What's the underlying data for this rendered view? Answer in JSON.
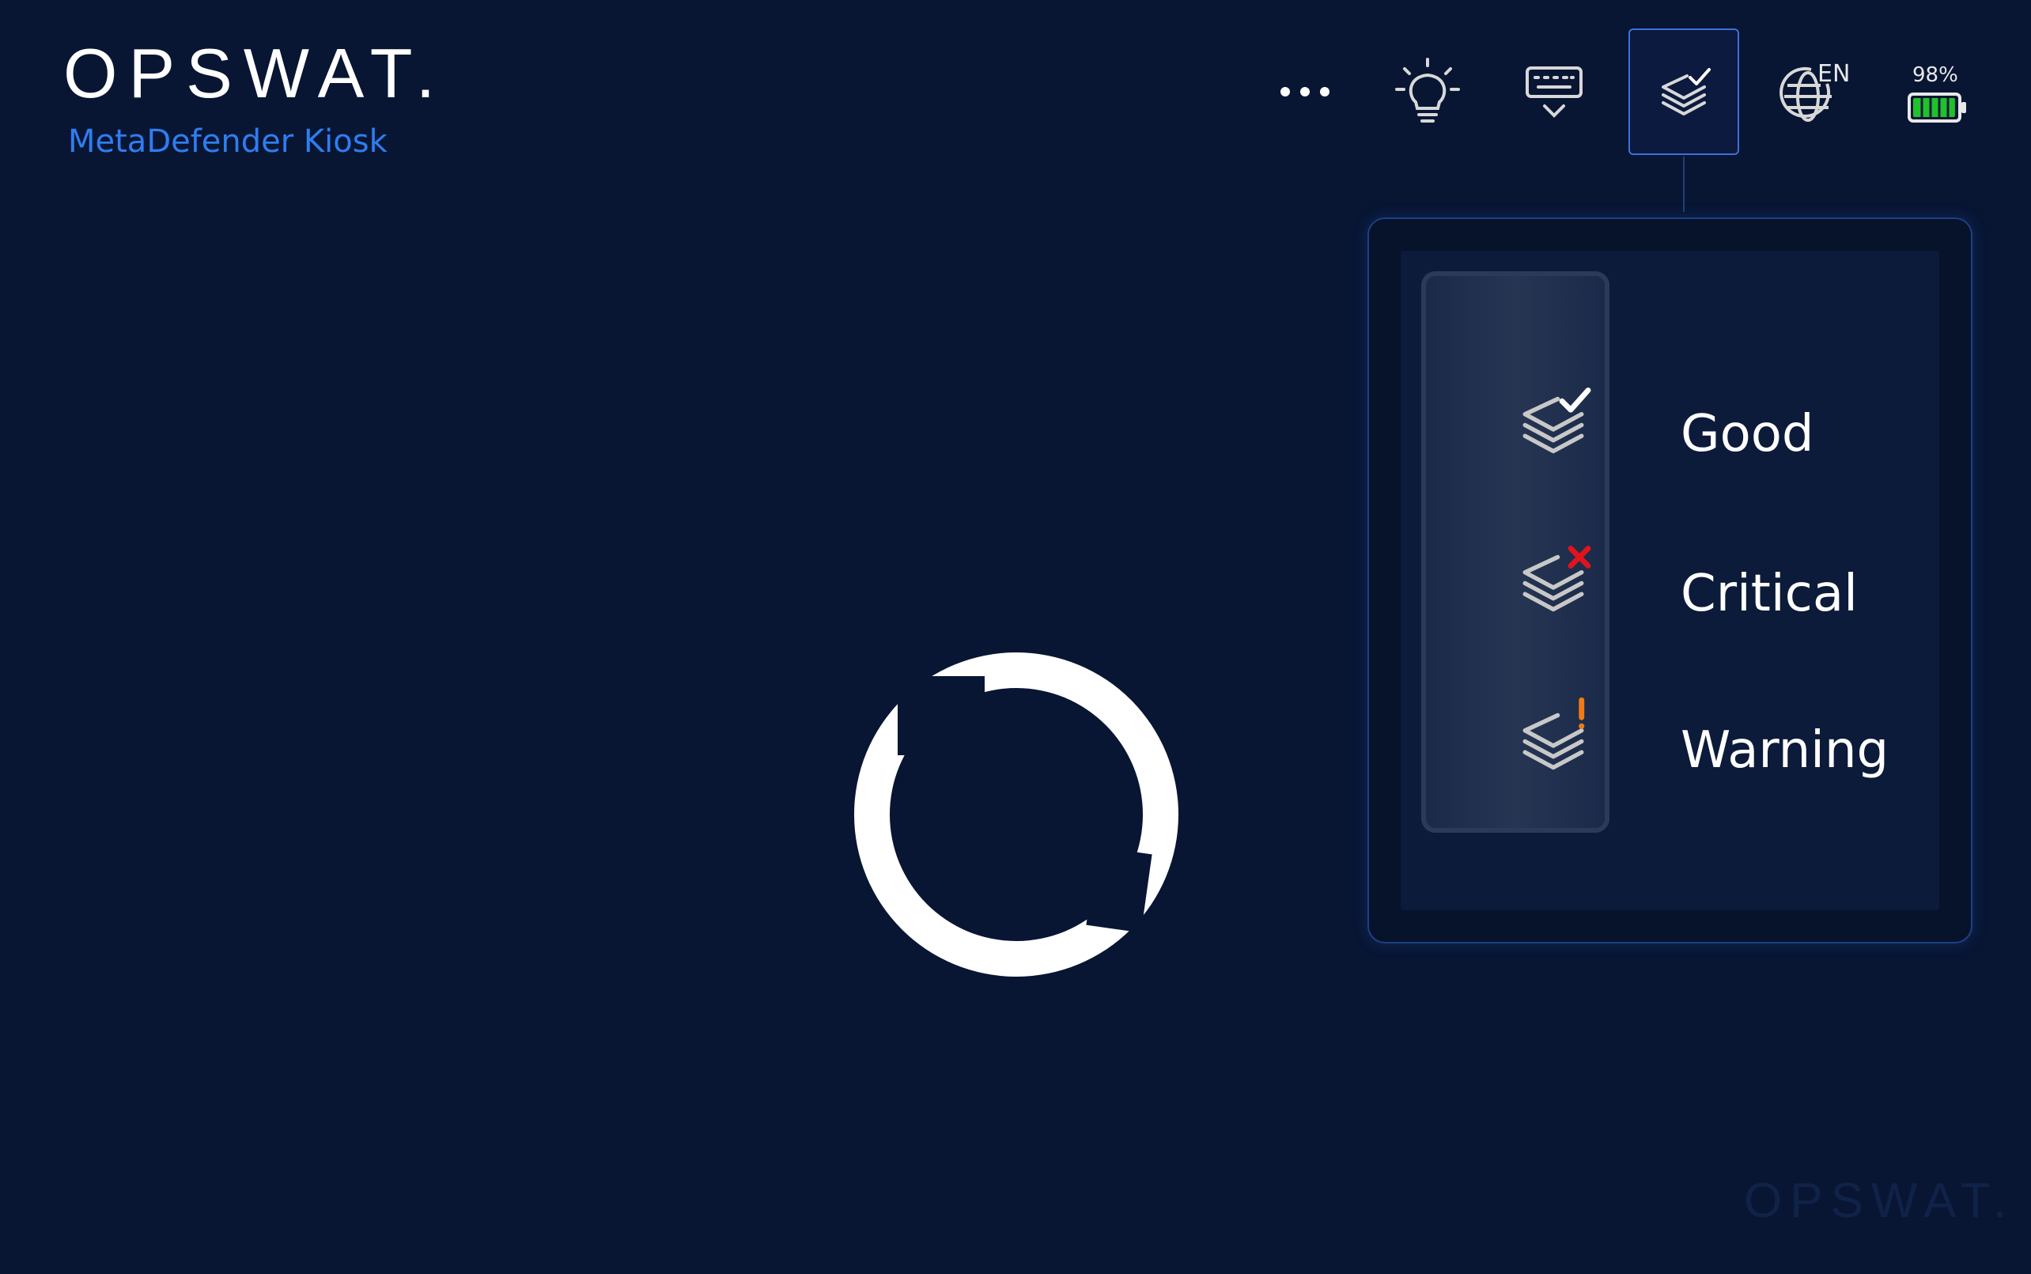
{
  "brand": {
    "logo": "OPSWAT.",
    "product": "MetaDefender Kiosk"
  },
  "toolbar": {
    "items": [
      {
        "id": "more",
        "icon": "more-dots-icon"
      },
      {
        "id": "hint",
        "icon": "lightbulb-icon"
      },
      {
        "id": "keyboard",
        "icon": "keyboard-icon"
      },
      {
        "id": "status",
        "icon": "layers-check-icon",
        "active": true
      },
      {
        "id": "language",
        "icon": "globe-icon",
        "label": "EN"
      },
      {
        "id": "battery",
        "icon": "battery-icon",
        "label": "98%",
        "level": 0.98
      }
    ]
  },
  "status_panel": {
    "items": [
      {
        "label": "Good",
        "icon": "layers-check-icon",
        "mark_color": "#ffffff"
      },
      {
        "label": "Critical",
        "icon": "layers-x-icon",
        "mark_color": "#e0141c"
      },
      {
        "label": "Warning",
        "icon": "layers-exclamation-icon",
        "mark_color": "#f07a16"
      }
    ]
  },
  "watermark": "OPSWAT.",
  "colors": {
    "background": "#081634",
    "accent": "#2f7df0",
    "battery_green": "#22c02a",
    "critical": "#e0141c",
    "warning": "#f07a16"
  }
}
